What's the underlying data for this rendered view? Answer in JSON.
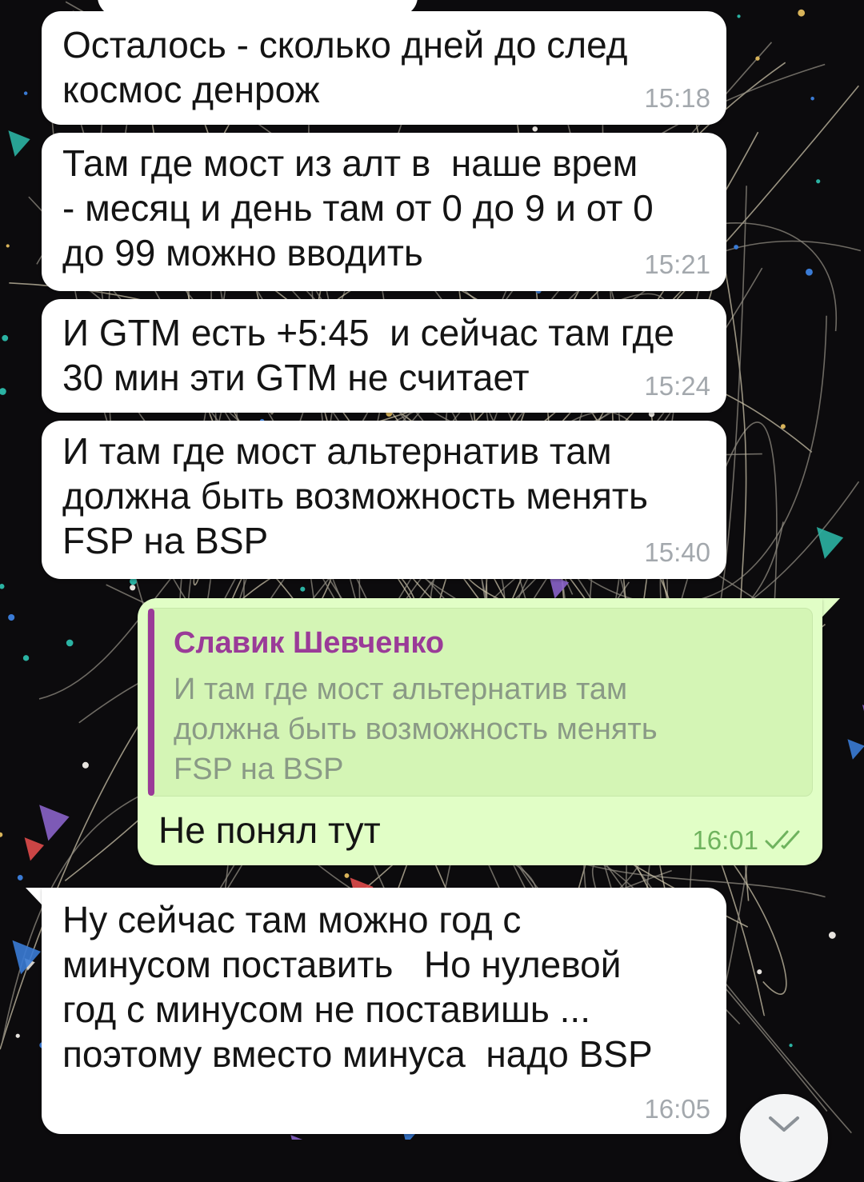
{
  "messages": [
    {
      "id": "m1",
      "direction": "incoming",
      "lines": [
        "Осталось - сколько дней до след",
        "космос денрож"
      ],
      "time": "15:18"
    },
    {
      "id": "m2",
      "direction": "incoming",
      "lines": [
        "Там где мост из алт в  наше врем",
        "- месяц и день там от 0 до 9 и от 0",
        "до 99 можно вводить"
      ],
      "time": "15:21"
    },
    {
      "id": "m3",
      "direction": "incoming",
      "lines": [
        "И GTM есть +5:45  и сейчас там где",
        "30 мин эти GTM не считает"
      ],
      "time": "15:24"
    },
    {
      "id": "m4",
      "direction": "incoming",
      "lines": [
        "И там где мост альтернатив там",
        "должна быть возможность менять",
        "FSP на BSP"
      ],
      "time": "15:40"
    },
    {
      "id": "m5",
      "direction": "outgoing",
      "reply": {
        "author": "Славик Шевченко",
        "lines": [
          "И там где мост альтернатив там",
          "должна быть возможность менять",
          "FSP на BSP"
        ]
      },
      "lines": [
        "Не понял тут"
      ],
      "time": "16:01",
      "status": "read-double-check"
    },
    {
      "id": "m6",
      "direction": "incoming",
      "lines": [
        "Ну сейчас там можно год с",
        "минусом поставить   Но нулевой",
        "год с минусом не поставишь ...",
        "поэтому вместо минуса  надо BSP"
      ],
      "time": "16:05"
    }
  ],
  "icons": {
    "read_status": "double-check-icon",
    "scroll_down": "chevron-down-icon"
  },
  "colors": {
    "incoming_bubble": "#ffffff",
    "outgoing_bubble": "#e1fec6",
    "reply_accent": "#9a3b98",
    "outgoing_time": "#6fb35e",
    "wallpaper": "#0c0b0d"
  }
}
